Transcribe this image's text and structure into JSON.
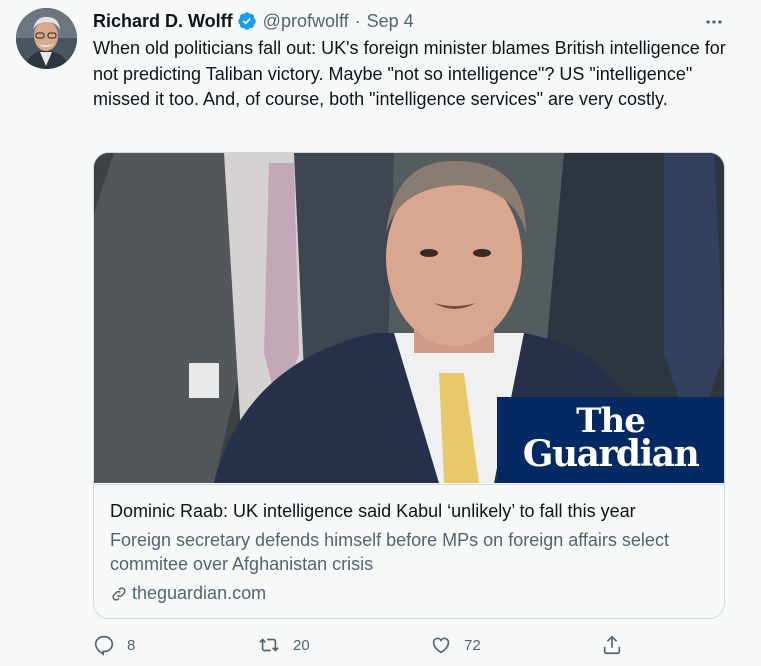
{
  "author": {
    "name": "Richard D. Wolff",
    "handle": "@profwolff",
    "separator": "·",
    "date": "Sep 4",
    "verified": true
  },
  "tweet": {
    "text": "When old politicians fall out: UK's foreign minister blames British intelligence for not predicting Taliban victory. Maybe \"not so intelligence\"? US \"intelligence\" missed it too. And, of course, both \"intelligence services\" are very costly."
  },
  "card": {
    "title": "Dominic Raab: UK intelligence said Kabul ‘unlikely’ to fall this year",
    "description": "Foreign secretary defends himself before MPs on foreign affairs select commitee over Afghanistan crisis",
    "domain": "theguardian.com",
    "brand_line1": "The",
    "brand_line2": "Guardian"
  },
  "actions": {
    "replies": "8",
    "retweets": "20",
    "likes": "72"
  },
  "colors": {
    "verified_blue": "#1d9bf0",
    "secondary_text": "#536471",
    "guardian_navy": "#052962",
    "background": "#f7f9f9"
  },
  "icons": [
    "more-icon",
    "reply-icon",
    "retweet-icon",
    "like-icon",
    "share-icon",
    "link-icon",
    "verified-badge-icon"
  ]
}
